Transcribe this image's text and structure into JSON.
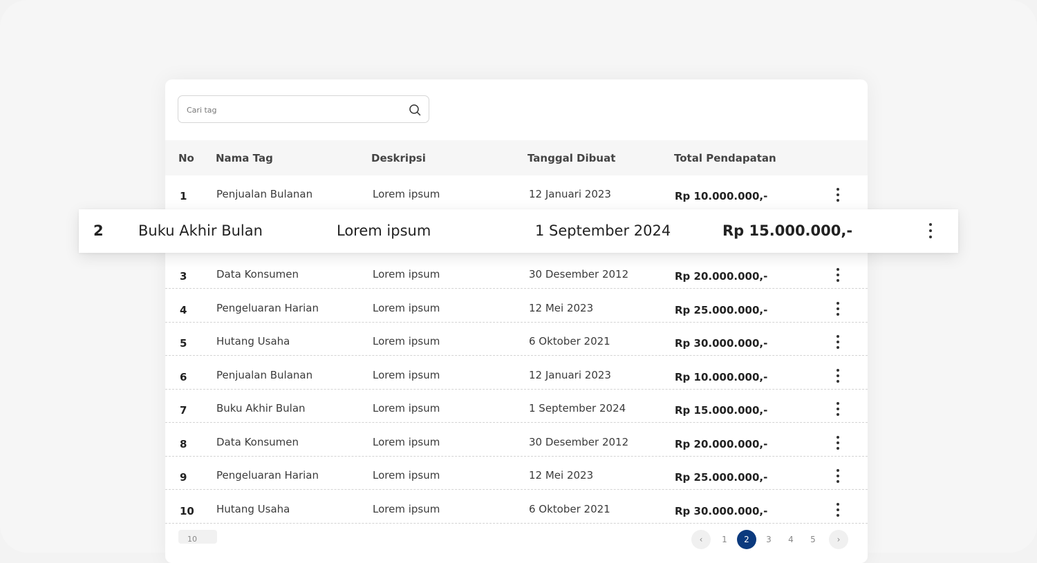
{
  "search": {
    "placeholder": "Cari tag"
  },
  "table": {
    "headers": [
      "No",
      "Nama Tag",
      "Deskripsi",
      "Tanggal Dibuat",
      "Total Pendapatan"
    ],
    "rows": [
      {
        "no": "1",
        "name": "Penjualan Bulanan",
        "desc": "Lorem ipsum",
        "date": "12 Januari 2023",
        "amount": "Rp 10.000.000,-"
      },
      {
        "no": "3",
        "name": "Data Konsumen",
        "desc": "Lorem ipsum",
        "date": "30 Desember 2012",
        "amount": "Rp 20.000.000,-"
      },
      {
        "no": "4",
        "name": "Pengeluaran Harian",
        "desc": "Lorem ipsum",
        "date": "12 Mei 2023",
        "amount": "Rp 25.000.000,-"
      },
      {
        "no": "5",
        "name": "Hutang Usaha",
        "desc": "Lorem ipsum",
        "date": "6 Oktober 2021",
        "amount": "Rp 30.000.000,-"
      },
      {
        "no": "6",
        "name": "Penjualan Bulanan",
        "desc": "Lorem ipsum",
        "date": "12 Januari 2023",
        "amount": "Rp 10.000.000,-"
      },
      {
        "no": "7",
        "name": "Buku Akhir Bulan",
        "desc": "Lorem ipsum",
        "date": "1 September 2024",
        "amount": "Rp 15.000.000,-"
      },
      {
        "no": "8",
        "name": "Data Konsumen",
        "desc": "Lorem ipsum",
        "date": "30 Desember 2012",
        "amount": "Rp 20.000.000,-"
      },
      {
        "no": "9",
        "name": "Pengeluaran Harian",
        "desc": "Lorem ipsum",
        "date": "12 Mei 2023",
        "amount": "Rp 25.000.000,-"
      },
      {
        "no": "10",
        "name": "Hutang Usaha",
        "desc": "Lorem ipsum",
        "date": "6 Oktober 2021",
        "amount": "Rp 30.000.000,-"
      }
    ],
    "dragged_row": {
      "no": "2",
      "name": "Buku Akhir Bulan",
      "desc": "Lorem ipsum",
      "date": "1 September 2024",
      "amount": "Rp 15.000.000,-"
    }
  },
  "footer": {
    "page_size": "10",
    "pages": [
      "1",
      "2",
      "3",
      "4",
      "5"
    ],
    "active_page": "2"
  },
  "colors": {
    "accent": "#0b3a7e"
  }
}
